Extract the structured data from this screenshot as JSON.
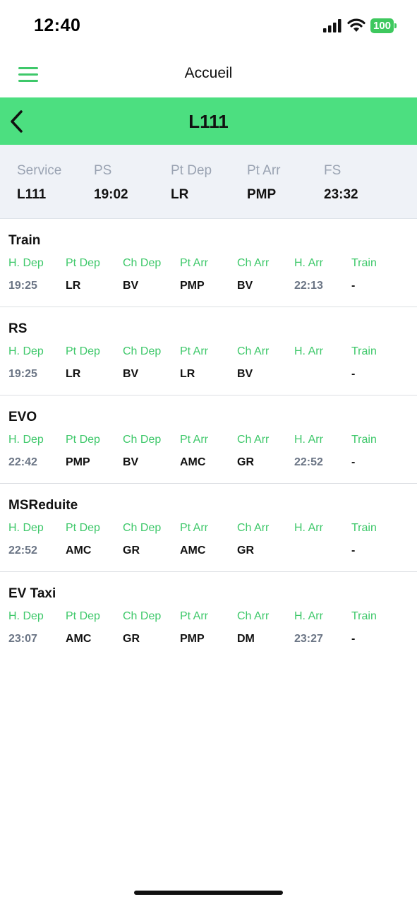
{
  "status_bar": {
    "time": "12:40",
    "battery_level": "100",
    "accent_color": "#3ec85e"
  },
  "nav": {
    "title": "Accueil",
    "menu_icon": "hamburger-menu-icon"
  },
  "header": {
    "title": "L111",
    "back_icon": "chevron-left-icon",
    "background_color": "#4cdf80"
  },
  "summary": {
    "columns": [
      {
        "label": "Service",
        "value": "L111"
      },
      {
        "label": "PS",
        "value": "19:02"
      },
      {
        "label": "Pt Dep",
        "value": "LR"
      },
      {
        "label": "Pt Arr",
        "value": "PMP"
      },
      {
        "label": "FS",
        "value": "23:32"
      }
    ]
  },
  "columns": [
    "H. Dep",
    "Pt Dep",
    "Ch Dep",
    "Pt Arr",
    "Ch Arr",
    "H. Arr",
    "Train"
  ],
  "sections": [
    {
      "title": "Train",
      "row": [
        "19:25",
        "LR",
        "BV",
        "PMP",
        "BV",
        "22:13",
        "-"
      ]
    },
    {
      "title": "RS",
      "row": [
        "19:25",
        "LR",
        "BV",
        "LR",
        "BV",
        "",
        "-"
      ]
    },
    {
      "title": "EVO",
      "row": [
        "22:42",
        "PMP",
        "BV",
        "AMC",
        "GR",
        "22:52",
        "-"
      ]
    },
    {
      "title": "MSReduite",
      "row": [
        "22:52",
        "AMC",
        "GR",
        "AMC",
        "GR",
        "",
        "-"
      ]
    },
    {
      "title": "EV Taxi",
      "row": [
        "23:07",
        "AMC",
        "GR",
        "PMP",
        "DM",
        "23:27",
        "-"
      ]
    }
  ]
}
